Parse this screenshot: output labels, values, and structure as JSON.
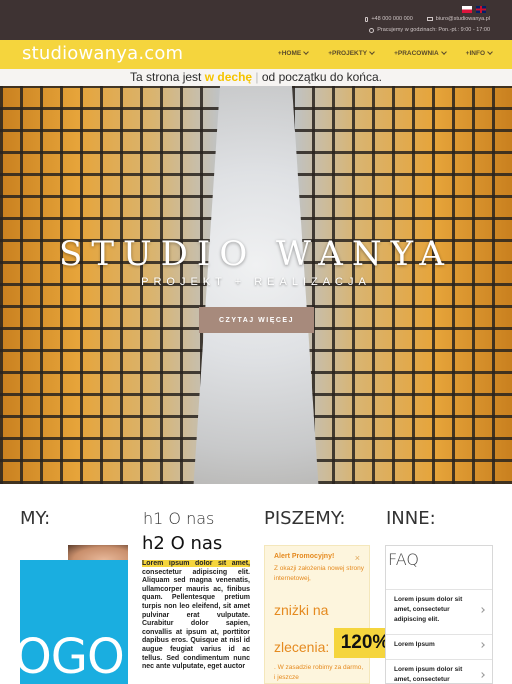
{
  "topbar": {
    "languages": [
      "pl",
      "en"
    ],
    "phone": "+48 000 000 000",
    "email": "biuro@studiowanya.pl",
    "hours": "Pracujemy w godzinach: Pon.-pt.: 9:00 - 17:00"
  },
  "nav": {
    "logo": "studiowanya.com",
    "items": [
      {
        "label": "+HOME"
      },
      {
        "label": "+PROJEKTY"
      },
      {
        "label": "+PRACOWNIA"
      },
      {
        "label": "+INFO"
      }
    ]
  },
  "tagline": {
    "before": "Ta strona jest ",
    "highlight": "w dechę",
    "separator": "|",
    "after": " od początku do końca."
  },
  "hero": {
    "title": "STUDIO WANYA",
    "subtitle": "PROJEKT + REALIZACJA",
    "button": "CZYTAJ WIĘCEJ"
  },
  "sections": {
    "my": {
      "title": "MY:",
      "ad_text": "OGO"
    },
    "onas": {
      "h1": "h1 O nas",
      "h2": "h2 O nas",
      "lorem_highlight": "Lorem ipsum dolor sit amet,",
      "lorem_body": " consectetur adipiscing elit. Aliquam sed magna venenatis, ullamcorper mauris ac, finibus quam. Pellentesque pretium turpis non leo eleifend, sit amet pulvinar erat vulputate. Curabitur dolor sapien, convallis at ipsum at, porttitor dapibus eros. Quisque at nisl id augue feugiat varius id ac tellus. Sed condimentum nunc nec ante vulputate, eget auctor"
    },
    "piszemy": {
      "title": "PISZEMY:",
      "promo_title": "Alert Promocyjny!",
      "promo_close": "×",
      "promo_text": "Z okazji założenia nowej strony internetowej,",
      "promo_znizki": "zniżki na",
      "promo_zlecenia": "zlecenia:",
      "promo_percent": "120%",
      "promo_note": ". W zasadzie robimy za darmo, i jeszcze"
    },
    "inne": {
      "title": "INNE:",
      "faq_title": "FAQ",
      "faq_items": [
        "Lorem ipsum dolor sit amet, consectetur adipiscing elit.",
        "Lorem Ipsum",
        "Lorem ipsum dolor sit amet, consectetur"
      ]
    }
  },
  "colors": {
    "topbar": "#3e3333",
    "nav_yellow": "#f5d53d",
    "button": "#a78a7c",
    "promo_orange": "#e58a1f",
    "ad_blue": "#1aaee0"
  }
}
